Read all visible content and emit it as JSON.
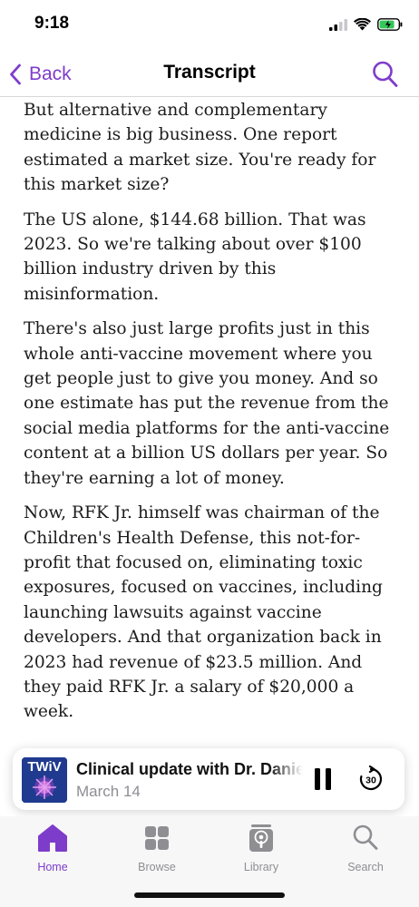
{
  "status": {
    "time": "9:18"
  },
  "nav": {
    "back_label": "Back",
    "title": "Transcript"
  },
  "transcript": {
    "paragraphs": [
      "But alternative and complementary medicine is big business. One report estimated a market size. You're ready for this market size?",
      "The US alone, $144.68 billion. That was 2023. So we're talking about over $100 billion industry driven by this misinformation.",
      "There's also just large profits just in this whole anti-vaccine movement where you get people just to give you money. And so one estimate has put the revenue from the social media platforms for the anti-vaccine content at a billion US dollars per year. So they're earning a lot of money.",
      "Now, RFK Jr. himself was chairman of the Children's Health Defense, this not-for-profit that focused on, eliminating toxic exposures, focused on vaccines, including launching lawsuits against vaccine developers. And that organization back in 2023 had revenue of $23.5 million. And they paid RFK Jr. a salary of $20,000 a week."
    ]
  },
  "player": {
    "artwork_text": "TWiV",
    "episode_title": "Clinical update with Dr. Daniel Griffin",
    "date": "March 14",
    "skip_seconds": "30"
  },
  "tabs": [
    {
      "label": "Home",
      "icon": "home-icon",
      "active": true
    },
    {
      "label": "Browse",
      "icon": "grid-icon",
      "active": false
    },
    {
      "label": "Library",
      "icon": "podcast-icon",
      "active": false
    },
    {
      "label": "Search",
      "icon": "search-icon",
      "active": false
    }
  ],
  "colors": {
    "accent": "#7e3ccb",
    "inactive": "#8e8e93"
  }
}
